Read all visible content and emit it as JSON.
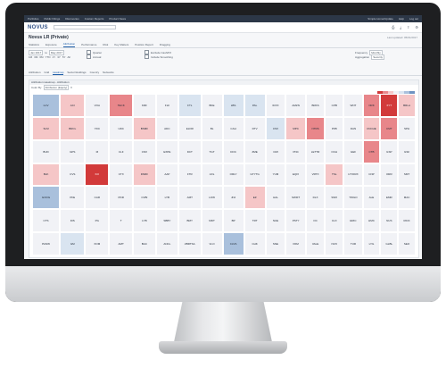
{
  "nav": {
    "links": [
      "Portfolios",
      "Public Filings",
      "Discoveries",
      "Custom Reports",
      "Product News"
    ],
    "right": [
      "Simple Home/Update",
      "Help",
      "Log out"
    ]
  },
  "app": {
    "logo": "NOVUS",
    "search_placeholder": "",
    "title": "Novus LR (Private)",
    "subtitle": "Last updated: 05/01/2017"
  },
  "tabs": [
    "Statistics",
    "Exposure",
    "Attribution",
    "Performance",
    "Risk",
    "Key Matters",
    "Position Report",
    "Dragging"
  ],
  "active_tab_index": 2,
  "controls": {
    "date_from": "Jan 2017",
    "date_to": "May 2017",
    "c1": "Quarter",
    "c2": "Annual",
    "checks": [
      "Exclude Cash/FX",
      "Include Smoothing"
    ],
    "right_labels": [
      "Frequency",
      "Aggregation"
    ],
    "right_values": [
      "Monthly",
      "Security"
    ],
    "ranges": [
      "1M",
      "3M",
      "6M",
      "YTD",
      "1Y",
      "3Y",
      "5Y",
      "All"
    ]
  },
  "subtabs": [
    "Attribution",
    "Grid",
    "Heatmap",
    "Sector/Holdings",
    "Country",
    "Networks"
  ],
  "active_subtab_index": 2,
  "panel": {
    "title": "Attribution Heatmap - Attribution",
    "filter_label": "Color By",
    "filter_value": "Attribution (Equity)"
  },
  "colors": {
    "neg_strong": "#d23a3a",
    "neg": "#e8868a",
    "neg_light": "#f5c6c7",
    "neutral": "#f1f2f6",
    "pos_light": "#d9e4f0",
    "pos": "#a9c0dc",
    "pos_strong": "#6f93c2"
  },
  "tiles": [
    {
      "label": "LUV",
      "c": "pos",
      "col": 0,
      "row": 0
    },
    {
      "label": "SLM",
      "c": "neg_light",
      "col": 0,
      "row": 1
    },
    {
      "label": "BUD",
      "c": "neutral",
      "col": 0,
      "row": 2
    },
    {
      "label": "BLK",
      "c": "neg_light",
      "col": 0,
      "row": 3
    },
    {
      "label": "GOOG",
      "c": "pos",
      "col": 0,
      "row": 4
    },
    {
      "label": "CTS",
      "c": "neutral",
      "col": 0,
      "row": 5
    },
    {
      "label": "PANW",
      "c": "neutral",
      "col": 0,
      "row": 6
    },
    {
      "label": "ACI",
      "c": "neg_light",
      "col": 1,
      "row": 0
    },
    {
      "label": "BRCL",
      "c": "neg_light",
      "col": 1,
      "row": 1
    },
    {
      "label": "GPS",
      "c": "neutral",
      "col": 1,
      "row": 2
    },
    {
      "label": "CVS",
      "c": "neutral",
      "col": 1,
      "row": 3
    },
    {
      "label": "PFE",
      "c": "neutral",
      "col": 1,
      "row": 4
    },
    {
      "label": "DIS",
      "c": "neutral",
      "col": 1,
      "row": 5
    },
    {
      "label": "GM",
      "c": "pos_light",
      "col": 1,
      "row": 6
    },
    {
      "label": "VOA",
      "c": "neutral",
      "col": 2,
      "row": 0
    },
    {
      "label": "YDC",
      "c": "neutral",
      "col": 2,
      "row": 1
    },
    {
      "label": "M",
      "c": "neutral",
      "col": 2,
      "row": 2
    },
    {
      "label": "KO",
      "c": "neg_strong",
      "col": 2,
      "row": 3
    },
    {
      "label": "CAR",
      "c": "neutral",
      "col": 2,
      "row": 4
    },
    {
      "label": "PG",
      "c": "neutral",
      "col": 2,
      "row": 5
    },
    {
      "label": "XOM",
      "c": "neutral",
      "col": 2,
      "row": 6
    },
    {
      "label": "TECK",
      "c": "neg",
      "col": 3,
      "row": 0
    },
    {
      "label": "UDC",
      "c": "neutral",
      "col": 3,
      "row": 1
    },
    {
      "label": "CLF",
      "c": "neutral",
      "col": 3,
      "row": 2
    },
    {
      "label": "CTX",
      "c": "neutral",
      "col": 3,
      "row": 3
    },
    {
      "label": "PDR",
      "c": "neutral",
      "col": 3,
      "row": 4
    },
    {
      "label": "T",
      "c": "neutral",
      "col": 3,
      "row": 5
    },
    {
      "label": "AMT",
      "c": "neutral",
      "col": 3,
      "row": 6
    },
    {
      "label": "KRF",
      "c": "neutral",
      "col": 4,
      "row": 0
    },
    {
      "label": "BSMF",
      "c": "neg_light",
      "col": 4,
      "row": 1
    },
    {
      "label": "CNX",
      "c": "neutral",
      "col": 4,
      "row": 2
    },
    {
      "label": "DNRF",
      "c": "neg_light",
      "col": 4,
      "row": 3
    },
    {
      "label": "CVBI",
      "c": "neutral",
      "col": 4,
      "row": 4
    },
    {
      "label": "LYB",
      "c": "neutral",
      "col": 4,
      "row": 5
    },
    {
      "label": "BAC",
      "c": "neutral",
      "col": 4,
      "row": 6
    },
    {
      "label": "FHI",
      "c": "neutral",
      "col": 5,
      "row": 0
    },
    {
      "label": "ADC",
      "c": "neutral",
      "col": 5,
      "row": 1
    },
    {
      "label": "EXPE",
      "c": "neutral",
      "col": 5,
      "row": 2
    },
    {
      "label": "AAP",
      "c": "neutral",
      "col": 5,
      "row": 3
    },
    {
      "label": "LYB",
      "c": "neutral",
      "col": 5,
      "row": 4
    },
    {
      "label": "SBBY",
      "c": "neutral",
      "col": 5,
      "row": 5
    },
    {
      "label": "ANCL",
      "c": "neutral",
      "col": 5,
      "row": 6
    },
    {
      "label": "FTL",
      "c": "pos_light",
      "col": 6,
      "row": 0
    },
    {
      "label": "ELDR",
      "c": "neutral",
      "col": 6,
      "row": 1
    },
    {
      "label": "DCT",
      "c": "neutral",
      "col": 6,
      "row": 2
    },
    {
      "label": "FTR",
      "c": "neutral",
      "col": 6,
      "row": 3
    },
    {
      "label": "AMT",
      "c": "neutral",
      "col": 6,
      "row": 4
    },
    {
      "label": "BMY",
      "c": "neutral",
      "col": 6,
      "row": 5
    },
    {
      "label": "ZBRTSA",
      "c": "neutral",
      "col": 6,
      "row": 6
    },
    {
      "label": "BKE",
      "c": "neutral",
      "col": 7,
      "row": 0
    },
    {
      "label": "BL",
      "c": "neutral",
      "col": 7,
      "row": 1
    },
    {
      "label": "TGT",
      "c": "neutral",
      "col": 7,
      "row": 2
    },
    {
      "label": "AXL",
      "c": "neutral",
      "col": 7,
      "row": 3
    },
    {
      "label": "LOW",
      "c": "neutral",
      "col": 7,
      "row": 4
    },
    {
      "label": "MDT",
      "c": "neutral",
      "col": 7,
      "row": 5
    },
    {
      "label": "VLO",
      "c": "neutral",
      "col": 7,
      "row": 6
    },
    {
      "label": "LBS",
      "c": "pos_light",
      "col": 8,
      "row": 0
    },
    {
      "label": "CAH",
      "c": "neutral",
      "col": 8,
      "row": 1
    },
    {
      "label": "DOC",
      "c": "neutral",
      "col": 8,
      "row": 2
    },
    {
      "label": "ORLY",
      "c": "neutral",
      "col": 8,
      "row": 3
    },
    {
      "label": "JNJ",
      "c": "neutral",
      "col": 8,
      "row": 4
    },
    {
      "label": "BP",
      "c": "neutral",
      "col": 8,
      "row": 5
    },
    {
      "label": "CLVS",
      "c": "pos",
      "col": 8,
      "row": 6
    },
    {
      "label": "PAL",
      "c": "pos_light",
      "col": 9,
      "row": 0
    },
    {
      "label": "DTV",
      "c": "neutral",
      "col": 9,
      "row": 1
    },
    {
      "label": "ZME",
      "c": "neutral",
      "col": 9,
      "row": 2
    },
    {
      "label": "GTYTG",
      "c": "neutral",
      "col": 9,
      "row": 3
    },
    {
      "label": "EZ",
      "c": "neg_light",
      "col": 9,
      "row": 4
    },
    {
      "label": "TRT",
      "c": "neutral",
      "col": 9,
      "row": 5
    },
    {
      "label": "CHK",
      "c": "neutral",
      "col": 9,
      "row": 6
    },
    {
      "label": "IDXX",
      "c": "neutral",
      "col": 10,
      "row": 0
    },
    {
      "label": "CSX",
      "c": "pos_light",
      "col": 10,
      "row": 1
    },
    {
      "label": "CMI",
      "c": "neutral",
      "col": 10,
      "row": 2
    },
    {
      "label": "YUM",
      "c": "neutral",
      "col": 10,
      "row": 3
    },
    {
      "label": "HAL",
      "c": "neutral",
      "col": 10,
      "row": 4
    },
    {
      "label": "NUE",
      "c": "neutral",
      "col": 10,
      "row": 5
    },
    {
      "label": "SNE",
      "c": "neutral",
      "col": 10,
      "row": 6
    },
    {
      "label": "AMZN",
      "c": "neutral",
      "col": 11,
      "row": 0
    },
    {
      "label": "MPC",
      "c": "neg_light",
      "col": 11,
      "row": 1
    },
    {
      "label": "PNC",
      "c": "neutral",
      "col": 11,
      "row": 2
    },
    {
      "label": "EQIX",
      "c": "neutral",
      "col": 11,
      "row": 3
    },
    {
      "label": "SWIFT",
      "c": "neutral",
      "col": 11,
      "row": 4
    },
    {
      "label": "PSTY",
      "c": "neutral",
      "col": 11,
      "row": 5
    },
    {
      "label": "PAM",
      "c": "neutral",
      "col": 11,
      "row": 6
    },
    {
      "label": "BRKS",
      "c": "neutral",
      "col": 12,
      "row": 0
    },
    {
      "label": "NTRS",
      "c": "neg",
      "col": 12,
      "row": 1
    },
    {
      "label": "LETTR",
      "c": "neutral",
      "col": 12,
      "row": 2
    },
    {
      "label": "VRTX",
      "c": "neutral",
      "col": 12,
      "row": 3
    },
    {
      "label": "DLX",
      "c": "neutral",
      "col": 12,
      "row": 4
    },
    {
      "label": "OC",
      "c": "neutral",
      "col": 12,
      "row": 5
    },
    {
      "label": "VALE",
      "c": "neutral",
      "col": 12,
      "row": 6
    },
    {
      "label": "CPB",
      "c": "neutral",
      "col": 13,
      "row": 0
    },
    {
      "label": "PFB",
      "c": "neutral",
      "col": 13,
      "row": 1
    },
    {
      "label": "OCH",
      "c": "neutral",
      "col": 13,
      "row": 2
    },
    {
      "label": "TSL",
      "c": "neg_light",
      "col": 13,
      "row": 3
    },
    {
      "label": "SWX",
      "c": "neutral",
      "col": 13,
      "row": 4
    },
    {
      "label": "CLX",
      "c": "neutral",
      "col": 13,
      "row": 5
    },
    {
      "label": "NVO",
      "c": "neutral",
      "col": 13,
      "row": 6
    },
    {
      "label": "WNT",
      "c": "neutral",
      "col": 14,
      "row": 0
    },
    {
      "label": "DAN",
      "c": "neutral",
      "col": 14,
      "row": 1
    },
    {
      "label": "GEF",
      "c": "neutral",
      "col": 14,
      "row": 2
    },
    {
      "label": "LTXFRX",
      "c": "neutral",
      "col": 14,
      "row": 3
    },
    {
      "label": "TWGO",
      "c": "neutral",
      "col": 14,
      "row": 4
    },
    {
      "label": "ERIC",
      "c": "neutral",
      "col": 14,
      "row": 5
    },
    {
      "label": "TUR",
      "c": "neutral",
      "col": 14,
      "row": 6
    },
    {
      "label": "ORK",
      "c": "neg",
      "col": 15,
      "row": 0
    },
    {
      "label": "CNCHE",
      "c": "neg_light",
      "col": 15,
      "row": 1
    },
    {
      "label": "CTB",
      "c": "neg",
      "col": 15,
      "row": 2
    },
    {
      "label": "CNP",
      "c": "neutral",
      "col": 15,
      "row": 3
    },
    {
      "label": "ALE",
      "c": "neutral",
      "col": 15,
      "row": 4
    },
    {
      "label": "HMC",
      "c": "neutral",
      "col": 15,
      "row": 5
    },
    {
      "label": "LYG",
      "c": "neutral",
      "col": 15,
      "row": 6
    },
    {
      "label": "XYT",
      "c": "neg_strong",
      "col": 16,
      "row": 0
    },
    {
      "label": "CMT",
      "c": "neg",
      "col": 16,
      "row": 1
    },
    {
      "label": "ILSP",
      "c": "neutral",
      "col": 16,
      "row": 2
    },
    {
      "label": "ORR",
      "c": "neutral",
      "col": 16,
      "row": 3
    },
    {
      "label": "EMR",
      "c": "neutral",
      "col": 16,
      "row": 4
    },
    {
      "label": "NUS",
      "c": "neutral",
      "col": 16,
      "row": 5
    },
    {
      "label": "GLBL",
      "c": "neutral",
      "col": 16,
      "row": 6
    },
    {
      "label": "BRLA",
      "c": "neg_light",
      "col": 17,
      "row": 0
    },
    {
      "label": "SPH",
      "c": "neutral",
      "col": 17,
      "row": 1
    },
    {
      "label": "GSF",
      "c": "neutral",
      "col": 17,
      "row": 2
    },
    {
      "label": "SMT",
      "c": "neutral",
      "col": 17,
      "row": 3
    },
    {
      "label": "MAC",
      "c": "neutral",
      "col": 17,
      "row": 4
    },
    {
      "label": "RICK",
      "c": "neutral",
      "col": 17,
      "row": 5
    },
    {
      "label": "SEO",
      "c": "neutral",
      "col": 17,
      "row": 6
    }
  ]
}
